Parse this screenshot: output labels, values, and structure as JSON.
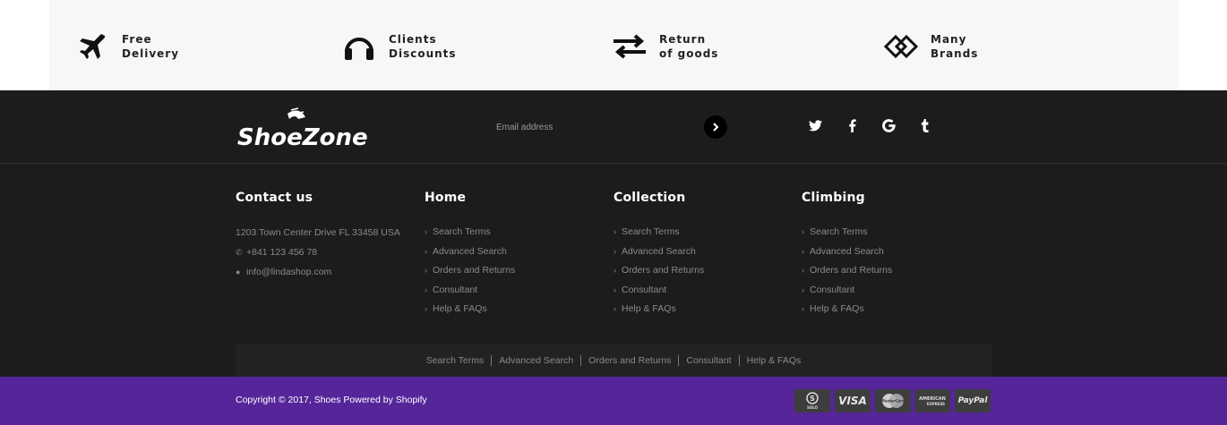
{
  "features": [
    {
      "icon": "airplane-icon",
      "line1": "Free",
      "line2": "Delivery"
    },
    {
      "icon": "headphones-icon",
      "line1": "Clients",
      "line2": "Discounts"
    },
    {
      "icon": "exchange-arrows-icon",
      "line1": "Return",
      "line2": "of goods"
    },
    {
      "icon": "diamond-links-icon",
      "line1": "Many",
      "line2": "Brands"
    }
  ],
  "logo": {
    "text": "ShoeZone"
  },
  "newsletter": {
    "placeholder": "Email address"
  },
  "social": [
    {
      "icon": "twitter-icon",
      "glyph": "🐦"
    },
    {
      "icon": "facebook-icon",
      "glyph": "f"
    },
    {
      "icon": "google-icon",
      "glyph": "G"
    },
    {
      "icon": "tumblr-icon",
      "glyph": "t"
    }
  ],
  "contact": {
    "title": "Contact us",
    "address": "1203 Town Center Drive FL 33458 USA",
    "phone": "+841 123 456 78",
    "email": "info@lindashop.com"
  },
  "columns": [
    {
      "title": "Home",
      "links": [
        "Search Terms",
        "Advanced Search",
        "Orders and Returns",
        "Consultant",
        "Help & FAQs"
      ]
    },
    {
      "title": "Collection",
      "links": [
        "Search Terms",
        "Advanced Search",
        "Orders and Returns",
        "Consultant",
        "Help & FAQs"
      ]
    },
    {
      "title": "Climbing",
      "links": [
        "Search Terms",
        "Advanced Search",
        "Orders and Returns",
        "Consultant",
        "Help & FAQs"
      ]
    }
  ],
  "bottom_links": [
    "Search Terms",
    "Advanced Search",
    "Orders and Returns",
    "Consultant",
    "Help & FAQs"
  ],
  "copyright": "Copyright © 2017, Shoes Powered by Shopify",
  "payments": [
    {
      "icon": "solo-icon",
      "label": "SOLO"
    },
    {
      "icon": "visa-icon",
      "label": "VISA"
    },
    {
      "icon": "mastercard-icon",
      "label": "MasterCard"
    },
    {
      "icon": "amex-icon",
      "label": "AMERICAN EXPRESS"
    },
    {
      "icon": "paypal-icon",
      "label": "PayPal"
    }
  ],
  "colors": {
    "footer_bg": "#1c1c1c",
    "strip_bg": "#56259a",
    "features_bg": "#f7f7f7"
  }
}
